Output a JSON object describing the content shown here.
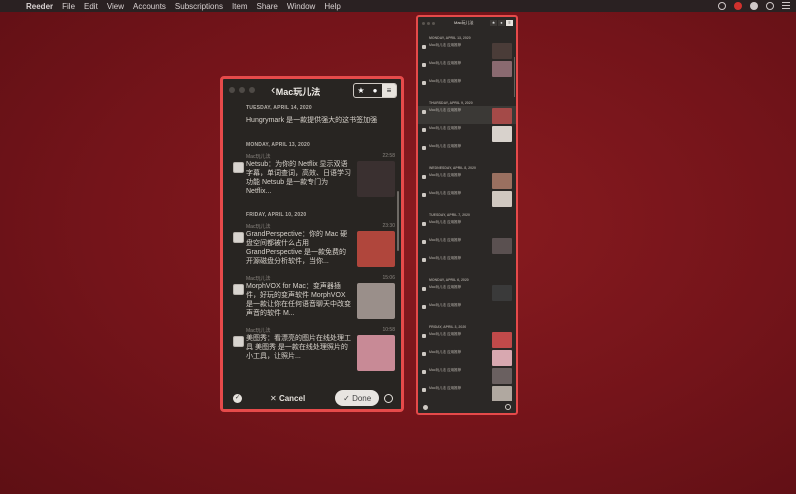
{
  "menubar": {
    "app": "Reeder",
    "items": [
      "File",
      "Edit",
      "View",
      "Accounts",
      "Subscriptions",
      "Item",
      "Share",
      "Window",
      "Help"
    ]
  },
  "main_window": {
    "title": "Mac玩儿法",
    "segments": [
      "★",
      "●",
      "≡"
    ],
    "active_segment": 2,
    "sections": [
      {
        "date": "TUESDAY, APRIL 14, 2020",
        "rows": [
          {
            "source": "",
            "time": "",
            "title": "Hungrymark 是一款提供强大的这书签加强",
            "thumb": ""
          }
        ]
      },
      {
        "date": "MONDAY, APRIL 13, 2020",
        "rows": [
          {
            "source": "Mac玩儿法",
            "time": "22:58",
            "title": "Netsub：为你的 Netflix 显示双语字幕，单词查词，高效、日语学习功能 Netsub 是一款专门为 Netflix...",
            "thumb": "#3a3030"
          }
        ]
      },
      {
        "date": "FRIDAY, APRIL 10, 2020",
        "rows": [
          {
            "source": "Mac玩儿法",
            "time": "23:30",
            "title": "GrandPerspective：你的 Mac 硬盘空间都被什么占用 GrandPerspective 是一款免费的开源磁盘分析软件，当你...",
            "thumb": "#b0463c"
          },
          {
            "source": "Mac玩儿法",
            "time": "15:06",
            "title": "MorphVOX for Mac：变声器插件，好玩的变声软件 MorphVOX 是一款让你在任何语音聊天中改变声音的软件 M...",
            "thumb": "#9a8f8a"
          },
          {
            "source": "Mac玩儿法",
            "time": "10:58",
            "title": "美图秀：看漂亮的图片在线处理工具 美图秀 是一款在线处理照片的小工具，让照片...",
            "thumb": "#c88a96"
          }
        ]
      }
    ],
    "toolbar": {
      "cancel": "Cancel",
      "done": "Done",
      "cancel_glyph": "✕",
      "done_glyph": "✓"
    }
  },
  "side_window": {
    "title": "Mac玩儿法",
    "sections": [
      {
        "date": "MONDAY, APRIL 13, 2020",
        "rows": [
          {
            "text": "Mac玩儿法 应用推荐",
            "thumb": "#4a3c38"
          },
          {
            "text": "Mac玩儿法 应用推荐",
            "thumb": "#8a6a70"
          },
          {
            "text": "Mac玩儿法 应用推荐",
            "thumb": ""
          }
        ]
      },
      {
        "date": "THURSDAY, APRIL 9, 2020",
        "rows": [
          {
            "text": "Mac玩儿法 应用推荐",
            "thumb": "#a44a48"
          },
          {
            "text": "Mac玩儿法 应用推荐",
            "thumb": "#d8d2cc"
          },
          {
            "text": "Mac玩儿法 应用推荐",
            "thumb": ""
          }
        ]
      },
      {
        "date": "WEDNESDAY, APRIL 8, 2020",
        "rows": [
          {
            "text": "Mac玩儿法 应用推荐",
            "thumb": "#9a7060"
          },
          {
            "text": "Mac玩儿法 应用推荐",
            "thumb": "#d0c8c0"
          }
        ]
      },
      {
        "date": "TUESDAY, APRIL 7, 2020",
        "rows": [
          {
            "text": "Mac玩儿法 应用推荐",
            "thumb": ""
          },
          {
            "text": "Mac玩儿法 应用推荐",
            "thumb": "#5a5050"
          },
          {
            "text": "Mac玩儿法 应用推荐",
            "thumb": ""
          }
        ]
      },
      {
        "date": "MONDAY, APRIL 6, 2020",
        "rows": [
          {
            "text": "Mac玩儿法 应用推荐",
            "thumb": "#3a3a3a"
          },
          {
            "text": "Mac玩儿法 应用推荐",
            "thumb": ""
          }
        ]
      },
      {
        "date": "FRIDAY, APRIL 3, 2020",
        "rows": [
          {
            "text": "Mac玩儿法 应用推荐",
            "thumb": "#c04a4a"
          },
          {
            "text": "Mac玩儿法 应用推荐",
            "thumb": "#d8a8b0"
          },
          {
            "text": "Mac玩儿法 应用推荐",
            "thumb": "#6a6060"
          },
          {
            "text": "Mac玩儿法 应用推荐",
            "thumb": "#b0a8a0"
          }
        ]
      }
    ]
  }
}
